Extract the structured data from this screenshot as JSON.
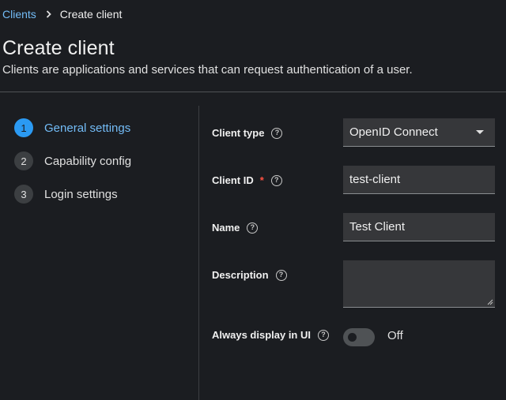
{
  "breadcrumb": {
    "parent": "Clients",
    "current": "Create client"
  },
  "header": {
    "title": "Create client",
    "subtitle": "Clients are applications and services that can request authentication of a user."
  },
  "steps": [
    {
      "number": "1",
      "label": "General settings",
      "active": true
    },
    {
      "number": "2",
      "label": "Capability config",
      "active": false
    },
    {
      "number": "3",
      "label": "Login settings",
      "active": false
    }
  ],
  "form": {
    "client_type": {
      "label": "Client type",
      "value": "OpenID Connect"
    },
    "client_id": {
      "label": "Client ID",
      "required_mark": "*",
      "value": "test-client"
    },
    "name": {
      "label": "Name",
      "value": "Test Client"
    },
    "description": {
      "label": "Description",
      "value": ""
    },
    "always_display": {
      "label": "Always display in UI",
      "state_text": "Off",
      "on": false
    }
  },
  "help_glyph": "?",
  "colors": {
    "accent": "#73bcf7",
    "active_step": "#2b9af3",
    "required": "#fe5142",
    "background": "#1b1d21",
    "input_bg": "#36373a"
  }
}
